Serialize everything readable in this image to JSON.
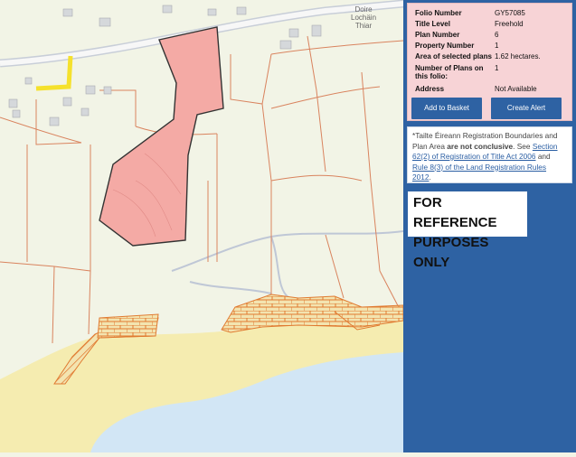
{
  "map": {
    "place_label_1": "Doire",
    "place_label_2": "Lochäin",
    "place_label_3": "Thiar",
    "colors": {
      "land": "#f2f4e6",
      "parcel_fill": "#f4aaa5",
      "parcel_stroke": "#333333",
      "boundary": "#d9835e",
      "beach": "#f5ecb0",
      "sea": "#d2e6f5",
      "road": "#c8ced8"
    }
  },
  "info_panel": {
    "rows": [
      {
        "label": "Folio Number",
        "value": "GY57085"
      },
      {
        "label": "Title Level",
        "value": "Freehold"
      },
      {
        "label": "Plan Number",
        "value": "6"
      },
      {
        "label": "Property Number",
        "value": "1"
      },
      {
        "label": "Area of selected plans",
        "value": "1.62 hectares."
      },
      {
        "label": "Number of Plans on",
        "label2": "this folio:",
        "value": "1"
      },
      {
        "label": "Address",
        "value": "Not Available"
      }
    ],
    "add_button": "Add to Basket",
    "alert_button": "Create Alert"
  },
  "note": {
    "text_1": "*Tailte Éireann Registration Boundaries and Plan Area ",
    "bold": "are not conclusive",
    "text_2": ". See ",
    "link_1": "Section 62(2) of Registration of Title Act 2006",
    "text_3": " and ",
    "link_2": "Rule 8(3) of the Land Registration Rules 2012",
    "text_4": "."
  },
  "reference": {
    "line1": "FOR REFERENCE",
    "line2": "PURPOSES ONLY"
  }
}
